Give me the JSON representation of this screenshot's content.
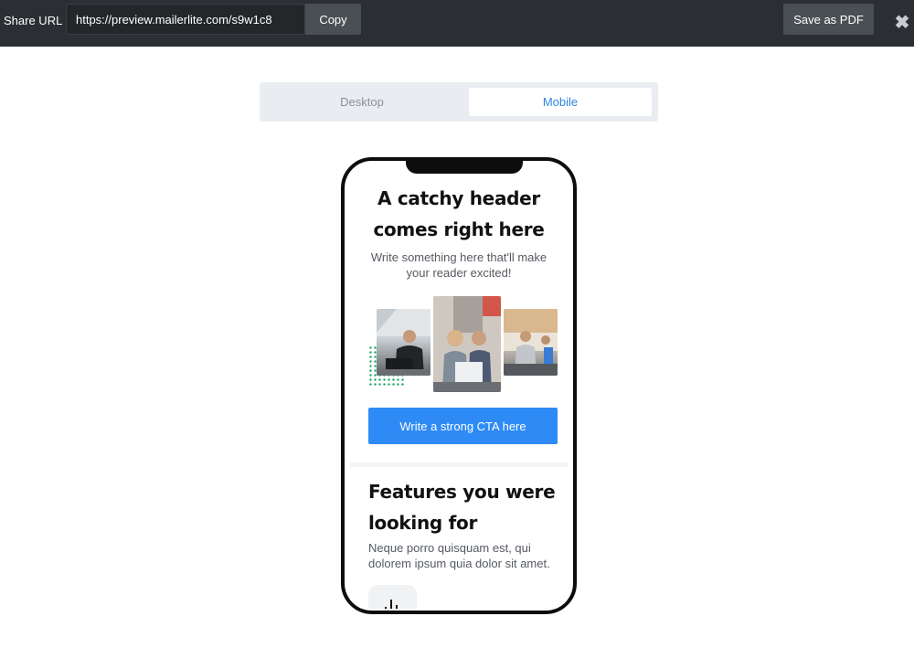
{
  "toolbar": {
    "share_label": "Share URL",
    "url_value": "https://preview.mailerlite.com/s9w1c8",
    "copy_label": "Copy",
    "save_pdf_label": "Save as PDF",
    "close_icon": "close-icon",
    "close_glyph": "✖"
  },
  "view_toggle": {
    "tabs": [
      {
        "label": "Desktop",
        "active": false
      },
      {
        "label": "Mobile",
        "active": true
      }
    ]
  },
  "preview": {
    "hero": {
      "title": "A catchy header comes right here",
      "subtitle": "Write something here that'll make your reader excited!",
      "cta_label": "Write a strong CTA here"
    },
    "features": {
      "title": "Features you were looking for",
      "text": "Neque porro quisquam est, qui dolorem ipsum quia dolor sit amet.",
      "icon": "chart-icon"
    }
  },
  "colors": {
    "toolbar_bg": "#2b2f33",
    "accent": "#2e8bf5",
    "active_tab_text": "#2b86e0",
    "dot_pattern": "#19a463"
  }
}
